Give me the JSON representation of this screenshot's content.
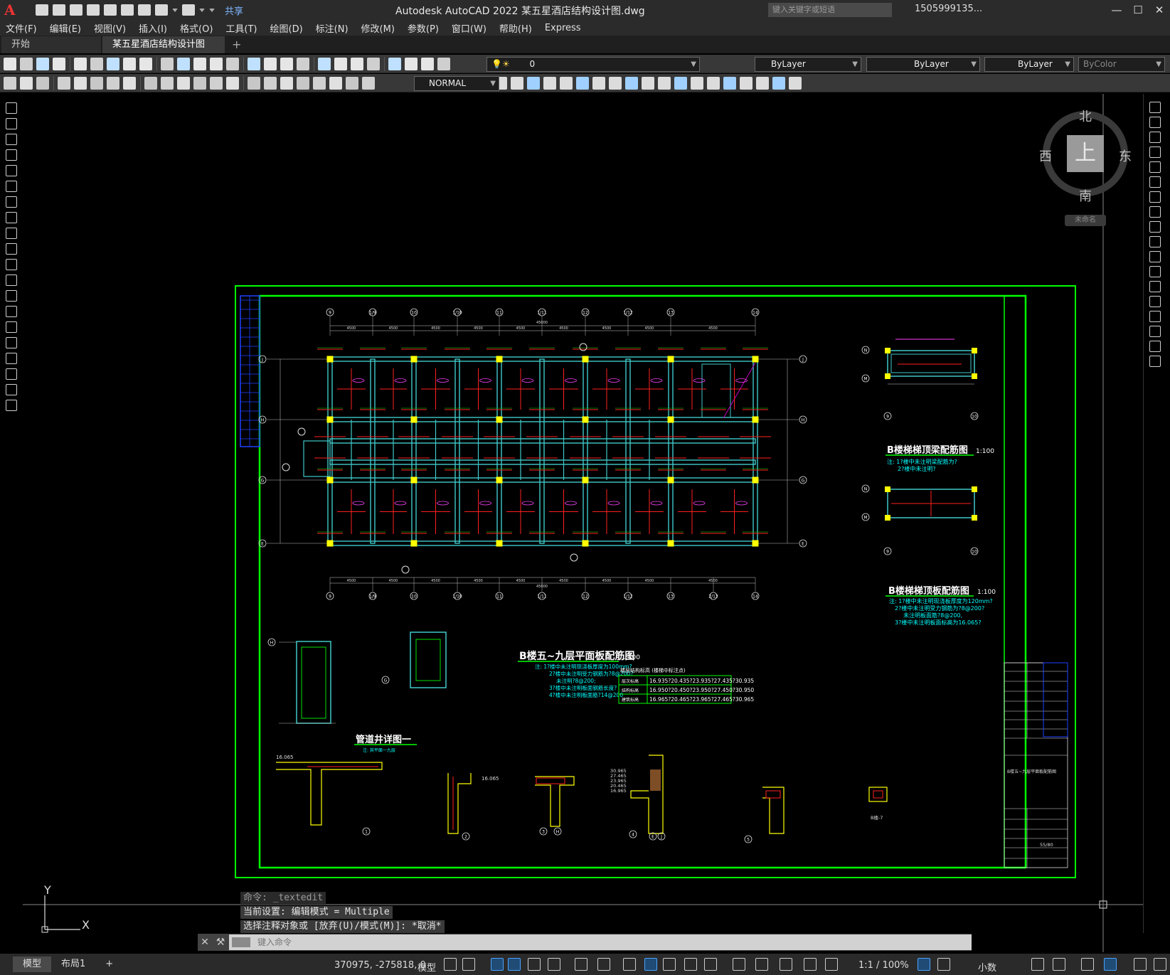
{
  "app": {
    "logo": "A",
    "title": "Autodesk AutoCAD 2022    某五星酒店结构设计图.dwg",
    "share_label": "共享",
    "search_placeholder": "键入关键字或短语",
    "user": "1505999135...",
    "accent": "#00ff00"
  },
  "menu": [
    "文件(F)",
    "编辑(E)",
    "视图(V)",
    "插入(I)",
    "格式(O)",
    "工具(T)",
    "绘图(D)",
    "标注(N)",
    "修改(M)",
    "参数(P)",
    "窗口(W)",
    "帮助(H)",
    "Express"
  ],
  "tabs": [
    {
      "label": "开始"
    },
    {
      "label": "某五星酒店结构设计图*",
      "active": true
    }
  ],
  "layer_combo": "0",
  "properties": {
    "color": "ByLayer",
    "linetype": "ByLayer",
    "lineweight": "ByLayer",
    "plotstyle": "ByColor"
  },
  "dimstyle_combo": "NORMAL",
  "viewcube": {
    "top": "上",
    "north": "北",
    "south": "南",
    "east": "东",
    "west": "西",
    "ucs_name": "未命名"
  },
  "ucs": {
    "y": "Y",
    "x": "X"
  },
  "drawing": {
    "main_title": "B楼五~九层平面板配筋图",
    "main_scale": "1:100",
    "stair_beam_title": "B楼梯梯顶梁配筋图",
    "stair_beam_scale": "1:100",
    "stair_slab_title": "B楼梯梯顶板配筋图",
    "stair_slab_scale": "1:100",
    "shaft_title": "管道井详图一",
    "shaft_note": "注: 其平面一九层",
    "grid_top": [
      "9",
      "1/9",
      "10",
      "1/10",
      "11",
      "1/11",
      "12",
      "1/12",
      "13",
      "14"
    ],
    "grid_bottom": [
      "9",
      "1/9",
      "10",
      "1/10",
      "11",
      "1/11",
      "12",
      "1/12",
      "13",
      "2/13",
      "14"
    ],
    "grid_left": [
      "J",
      "H",
      "G",
      "E"
    ],
    "stair_grid_beam": [
      "N",
      "M"
    ],
    "stair_grid_slab": [
      "N",
      "M"
    ],
    "stair_bottom_axis": [
      "9",
      "10"
    ],
    "dimension_text": "4500",
    "overall_dim": "45000",
    "table_rows": [
      {
        "label": "层次标高",
        "value": "16.935?20.435?23.935?27.435?30.935"
      },
      {
        "label": "结构标高",
        "value": "16.950?20.450?23.950?27.450?30.950"
      },
      {
        "label": "建筑标高",
        "value": "16.965?20.465?23.965?27.465?30.965"
      }
    ],
    "table_header": "楼层结构标高  (楼梯中标注点)",
    "note_main": [
      "注: 1?楼中未注明现浇板厚度为100mm?",
      "2?楼中未注明受力钢筋为?8@200?",
      "未注明?8@200;",
      "3?楼中未注明板面钢筋长度?",
      "4?楼中未注明板面筋?14@200"
    ],
    "note_stair_beam": [
      "注: 1?楼中未注明梁配筋为?",
      "2?楼中未注明?"
    ],
    "note_stair_slab": [
      "注: 1?楼中未注明现浇板厚度为120mm?",
      "2?楼中未注明受力钢筋为?8@200?",
      "未注明板面筋?8@200,",
      "3?楼中未注明板面标高为16.065?"
    ],
    "details": [
      "1",
      "2",
      "3",
      "4",
      "5"
    ],
    "detail_labels": {
      "d3_axis": "H",
      "d4_axis_a": "E",
      "d4_axis_b": "J",
      "d6_tag": "B楼-7"
    },
    "elev_labels": [
      "16.065",
      "16.065",
      "30.965",
      "27.465",
      "23.965",
      "20.465",
      "16.965"
    ],
    "titleblock_sheet": "55/80",
    "titleblock_title": "B楼五~九层平面板配筋图"
  },
  "command": {
    "history": [
      "命令: _textedit",
      "当前设置: 编辑模式 = Multiple",
      "选择注释对象或 [放弃(U)/模式(M)]: *取消*"
    ],
    "placeholder": "键入命令"
  },
  "status": {
    "model_tab": "模型",
    "layout_tab": "布局1",
    "add": "+",
    "coords": "370975, -275818, 0",
    "model_label": "模型",
    "scale": "1:1 / 100%",
    "units": "小数"
  }
}
